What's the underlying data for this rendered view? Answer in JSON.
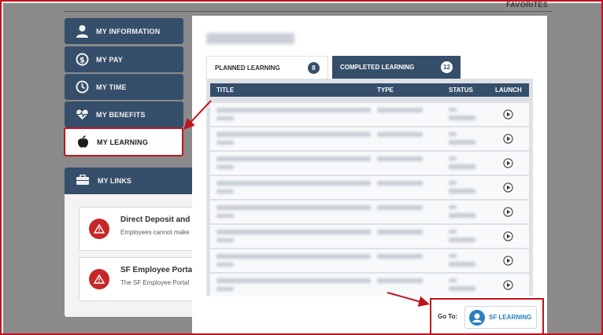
{
  "header": {
    "favorites_label": "FAVORITES"
  },
  "sidebar": {
    "items": [
      {
        "label": "MY INFORMATION",
        "icon": "person-icon"
      },
      {
        "label": "MY PAY",
        "icon": "dollar-circle-icon"
      },
      {
        "label": "MY TIME",
        "icon": "clock-icon"
      },
      {
        "label": "MY BENEFITS",
        "icon": "heart-pulse-icon"
      },
      {
        "label": "MY LEARNING",
        "icon": "apple-icon",
        "active": true
      }
    ]
  },
  "links": {
    "title": "MY LINKS",
    "cards": [
      {
        "title": "Direct Deposit and W",
        "desc": "Employees cannot make"
      },
      {
        "title": "SF Employee Portal",
        "desc": "The SF Employee Portal"
      }
    ]
  },
  "modal": {
    "tabs": [
      {
        "label": "PLANNED LEARNING",
        "count": "8"
      },
      {
        "label": "COMPLETED LEARNING",
        "count": "12"
      }
    ],
    "columns": {
      "title": "TITLE",
      "type": "TYPE",
      "status": "STATUS",
      "launch": "LAUNCH"
    },
    "row_count": 8,
    "goto_label": "Go To:",
    "sf_button_label": "SF LEARNING"
  },
  "colors": {
    "nav": "#354e6a",
    "highlight": "#c1121f",
    "link_blue": "#2a7fbf"
  }
}
